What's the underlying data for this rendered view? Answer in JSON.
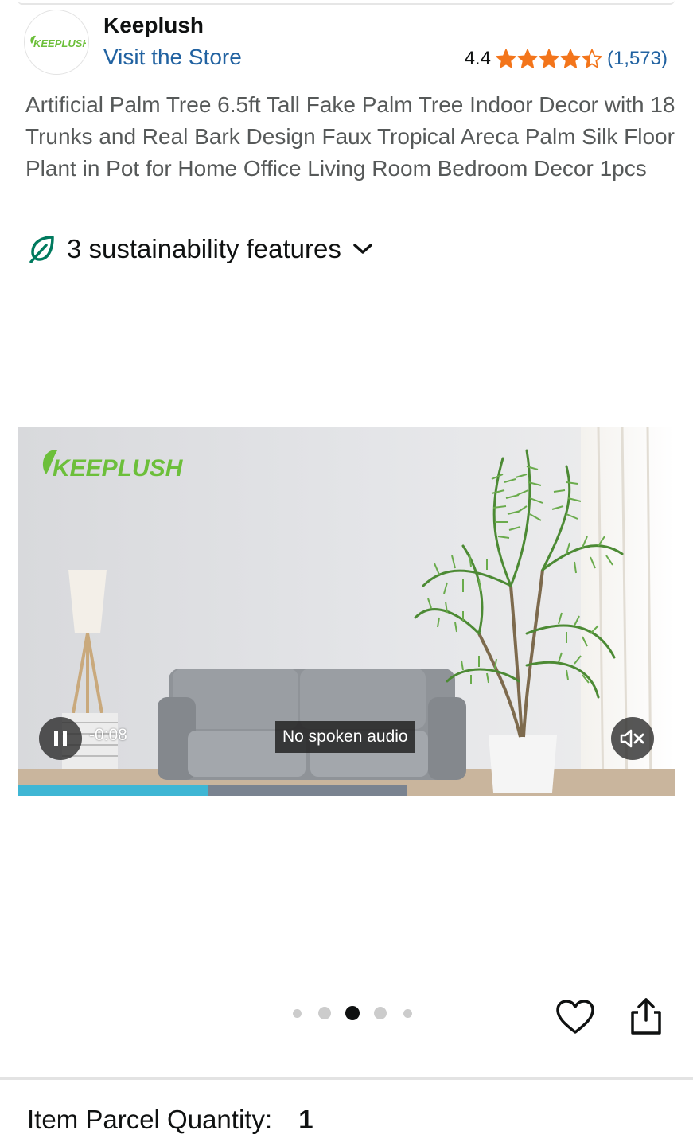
{
  "brand": {
    "name": "Keeplush",
    "logo_text": "KEEPLUSH",
    "store_link": "Visit the Store"
  },
  "rating": {
    "value": "4.4",
    "stars": 4.4,
    "count": "(1,573)",
    "star_color": "#f3751b"
  },
  "product": {
    "title": "Artificial Palm Tree 6.5ft Tall Fake Palm Tree Indoor Decor with 18 Trunks and Real Bark Design Faux Tropical Areca Palm Silk Floor Plant in Pot for Home Office Living Room Bedroom Decor 1pcs"
  },
  "sustainability": {
    "label": "3 sustainability features",
    "icon": "leaf-icon",
    "icon_color": "#007a5e"
  },
  "video": {
    "watermark": "KEEPLUSH",
    "time": "-0:08",
    "caption": "No spoken audio",
    "progress_fraction": 0.487,
    "progress_color": "#3fb6d4",
    "playing": true,
    "muted": true
  },
  "carousel": {
    "count": 5,
    "active_index": 2
  },
  "actions": {
    "wishlist_icon": "heart-icon",
    "share_icon": "share-icon"
  },
  "parcel": {
    "label": "Item Parcel Quantity:",
    "value": "1"
  }
}
